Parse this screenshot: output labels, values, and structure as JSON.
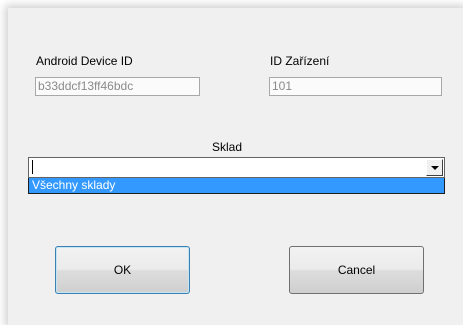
{
  "form": {
    "android_device_id": {
      "label": "Android Device ID",
      "value": "b33ddcf13ff46bdc"
    },
    "device_id": {
      "label": "ID Zařízení",
      "value": "101"
    },
    "warehouse": {
      "label": "Sklad",
      "value": "",
      "options": [
        "Všechny sklady"
      ],
      "highlighted_option": "Všechny sklady"
    }
  },
  "buttons": {
    "ok_label": "OK",
    "cancel_label": "Cancel"
  },
  "colors": {
    "dialog_background": "#f0f0f0",
    "selection_highlight": "#3399ff",
    "disabled_text": "#8a8a8a"
  }
}
